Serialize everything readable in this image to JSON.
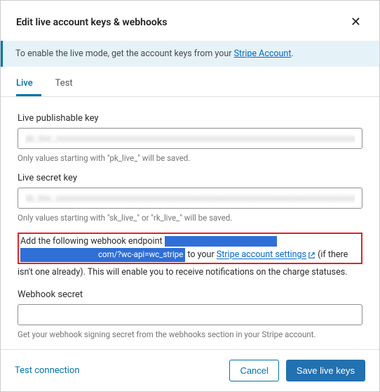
{
  "header": {
    "title": "Edit live account keys & webhooks",
    "close": "✕"
  },
  "banner": {
    "prefix": "To enable the live mode, get the account keys from your ",
    "link_text": "Stripe Account",
    "suffix": "."
  },
  "tabs": {
    "live": "Live",
    "test": "Test"
  },
  "fields": {
    "pub_key": {
      "label": "Live publishable key",
      "value": "pk_live_xxxxxxxxxxxxxxxxxxxxxxxxxxxxxxxxxxxxxxxxxxxxxxxxxxxxxxxxxxxxxxxxxxxxxxxxxxxxxxxxxxxxxxxxxxxx",
      "hint": "Only values starting with \"pk_live_\" will be saved."
    },
    "secret_key": {
      "label": "Live secret key",
      "value": "sk_live_xxxxxxxxxxxxxxxxxxxxxxxxxxxxxxxxxxxxxxxxxxxxxxxxxxxxxxxxxxxxxxxxxxxxxxxxxxxxxxxxxxxxxxxxxxxx",
      "hint": "Only values starting with \"sk_live_\" or \"rk_live_\" will be saved."
    },
    "webhook": {
      "intro": "Add the following webhook endpoint ",
      "url_frag": "com/?wc-api=wc_stripe",
      "mid": " to your ",
      "link": "Stripe account settings",
      "after1": " (if there",
      "after2": "isn't one already). This will enable you to receive notifications on the charge statuses."
    },
    "webhook_secret": {
      "label": "Webhook secret",
      "value": "",
      "hint": "Get your webhook signing secret from the webhooks section in your Stripe account."
    }
  },
  "footer": {
    "test": "Test connection",
    "cancel": "Cancel",
    "save": "Save live keys"
  }
}
